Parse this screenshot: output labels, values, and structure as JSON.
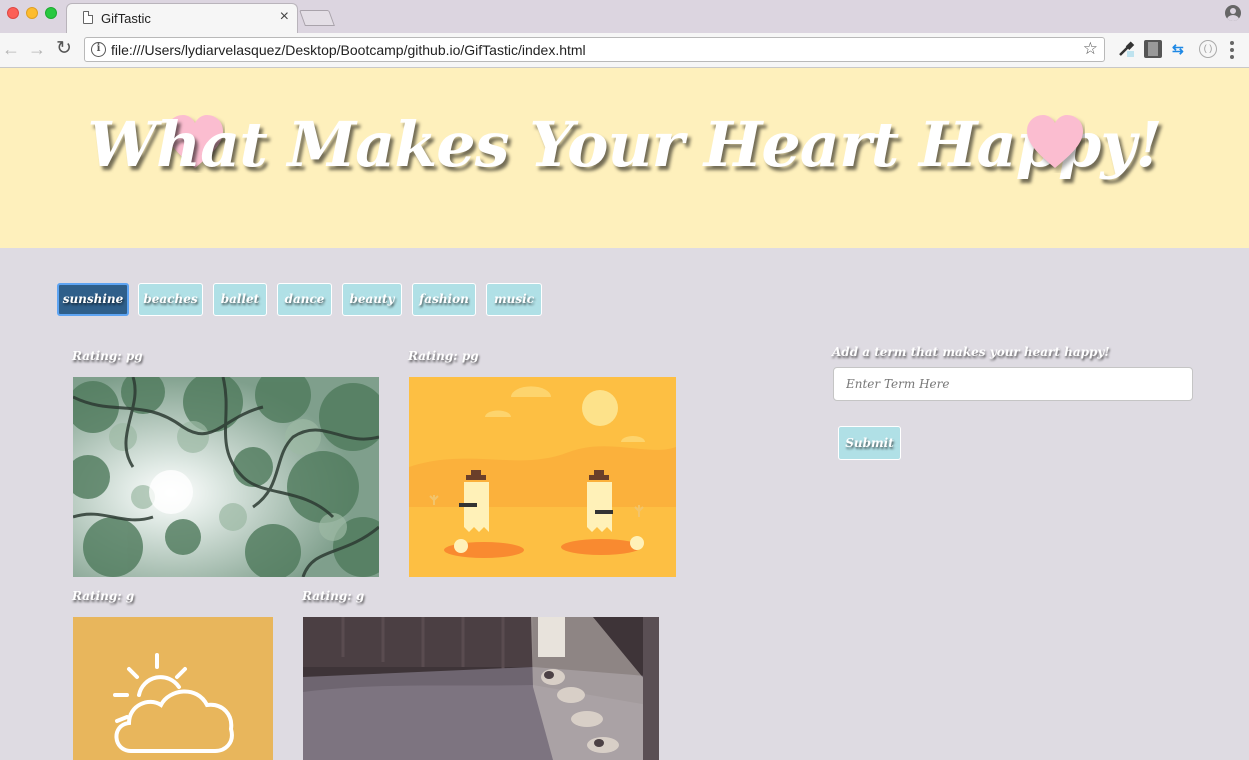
{
  "browser": {
    "tab_title": "GifTastic",
    "tab_close": "×",
    "url": "file:///Users/lydiarvelasquez/Desktop/Bootcamp/github.io/GifTastic/index.html",
    "icons": [
      "back-arrow-icon",
      "forward-arrow-icon",
      "reload-icon",
      "info-icon",
      "star-icon",
      "eyedropper-icon",
      "film-icon",
      "arrows-icon",
      "extension-circle-icon",
      "menu-icon",
      "profile-icon"
    ]
  },
  "header": {
    "title": "What Makes Your Heart Happy!",
    "background": "#fef0bc",
    "heart_color": "#fbbdd0"
  },
  "topics": {
    "items": [
      {
        "label": "sunshine",
        "active": true
      },
      {
        "label": "beaches",
        "active": false
      },
      {
        "label": "ballet",
        "active": false
      },
      {
        "label": "dance",
        "active": false
      },
      {
        "label": "beauty",
        "active": false
      },
      {
        "label": "fashion",
        "active": false
      },
      {
        "label": "music",
        "active": false
      }
    ],
    "button_color": "#b0e0e6",
    "active_color": "#2f5f8a"
  },
  "gifs": [
    {
      "rating": "Rating: pg",
      "image": "trees-canopy-gif"
    },
    {
      "rating": "Rating: pg",
      "image": "desert-cowboy-duel-gif"
    },
    {
      "rating": "Rating: g",
      "image": "sun-cloud-weather-icon-gif"
    },
    {
      "rating": "Rating: g",
      "image": "cats-sunbathing-gif"
    }
  ],
  "form": {
    "label": "Add a term that makes your heart happy!",
    "placeholder": "Enter Term Here",
    "value": "",
    "submit_label": "Submit"
  },
  "page_background": "#dedbe2"
}
